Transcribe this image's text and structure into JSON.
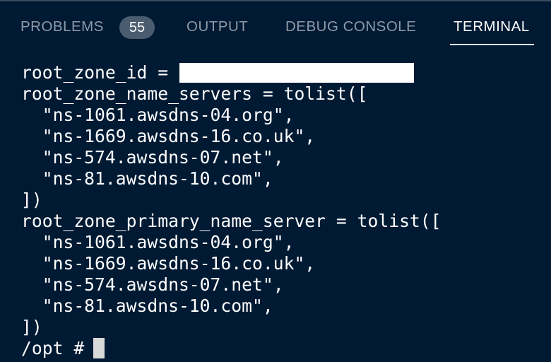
{
  "panel": {
    "tabs": [
      {
        "label": "PROBLEMS",
        "active": false
      },
      {
        "label": "OUTPUT",
        "active": false
      },
      {
        "label": "DEBUG CONSOLE",
        "active": false
      },
      {
        "label": "TERMINAL",
        "active": true
      }
    ],
    "problems_count": "55"
  },
  "terminal": {
    "lines": [
      "root_zone_id = ",
      "root_zone_name_servers = tolist([",
      "  \"ns-1061.awsdns-04.org\",",
      "  \"ns-1669.awsdns-16.co.uk\",",
      "  \"ns-574.awsdns-07.net\",",
      "  \"ns-81.awsdns-10.com\",",
      "])",
      "root_zone_primary_name_server = tolist([",
      "  \"ns-1061.awsdns-04.org\",",
      "  \"ns-1669.awsdns-16.co.uk\",",
      "  \"ns-574.awsdns-07.net\",",
      "  \"ns-81.awsdns-10.com\",",
      "])",
      "/opt # "
    ]
  },
  "colors": {
    "background": "#001a33",
    "tab_inactive": "#8d9aa8",
    "tab_active": "#ffffff",
    "badge_bg": "#4a5c70",
    "text": "#ffffff"
  }
}
